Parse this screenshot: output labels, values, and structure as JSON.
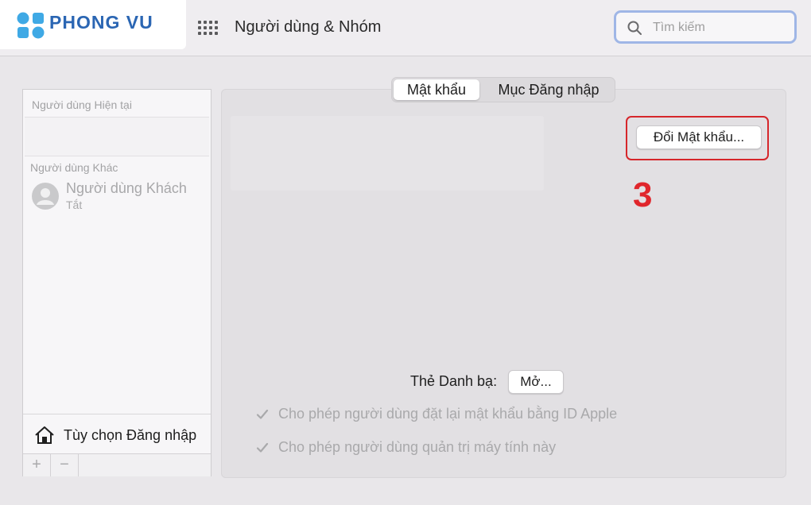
{
  "brand": {
    "logo_text": "PHONG VU"
  },
  "window": {
    "title": "Người dùng & Nhóm"
  },
  "search": {
    "placeholder": "Tìm kiếm",
    "value": ""
  },
  "sidebar": {
    "current_users_label": "Người dùng Hiện tại",
    "other_users_label": "Người dùng Khác",
    "guest_user": {
      "name": "Người dùng Khách",
      "status": "Tắt"
    },
    "login_options_label": "Tùy chọn Đăng nhập",
    "add_label": "+",
    "remove_label": "−"
  },
  "tabs": [
    {
      "label": "Mật khẩu",
      "active": true
    },
    {
      "label": "Mục Đăng nhập",
      "active": false
    }
  ],
  "main": {
    "change_password_label": "Đổi Mật khẩu...",
    "annotation_number": "3",
    "contact_card_label": "Thẻ Danh bạ:",
    "open_button_label": "Mở...",
    "checkbox_reset_label": "Cho phép người dùng đặt lại mật khẩu bằng ID Apple",
    "checkbox_admin_label": "Cho phép người dùng quản trị máy tính này"
  },
  "colors": {
    "annotation_red": "#e0262c",
    "brand_blue": "#2b66b3",
    "search_focus": "#9fb6e6"
  }
}
